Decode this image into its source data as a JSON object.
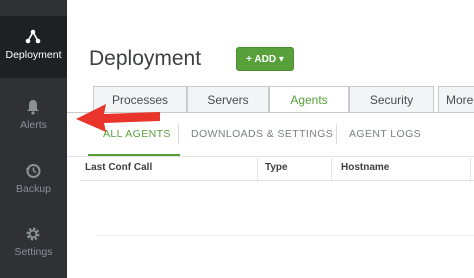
{
  "sidebar": {
    "items": [
      {
        "label": "Deployment",
        "icon": "deployment-icon",
        "active": true
      },
      {
        "label": "Alerts",
        "icon": "bell-icon",
        "active": false
      },
      {
        "label": "Backup",
        "icon": "history-clock-icon",
        "active": false
      },
      {
        "label": "Settings",
        "icon": "gear-icon",
        "active": false
      }
    ]
  },
  "header": {
    "title": "Deployment",
    "add_button_label": "+ ADD ▾"
  },
  "tabs": [
    {
      "label": "Processes",
      "active": false
    },
    {
      "label": "Servers",
      "active": false
    },
    {
      "label": "Agents",
      "active": true
    },
    {
      "label": "Security",
      "active": false
    },
    {
      "label": "More",
      "active": false
    }
  ],
  "subnav": [
    {
      "label": "ALL AGENTS",
      "active": true
    },
    {
      "label": "DOWNLOADS & SETTINGS",
      "active": false
    },
    {
      "label": "AGENT LOGS",
      "active": false
    }
  ],
  "table": {
    "columns": [
      "Last Conf Call",
      "Type",
      "Hostname"
    ]
  },
  "colors": {
    "accent_green": "#58a13a",
    "sidebar_bg": "#2f3135",
    "annotation_arrow": "#e8342a"
  }
}
